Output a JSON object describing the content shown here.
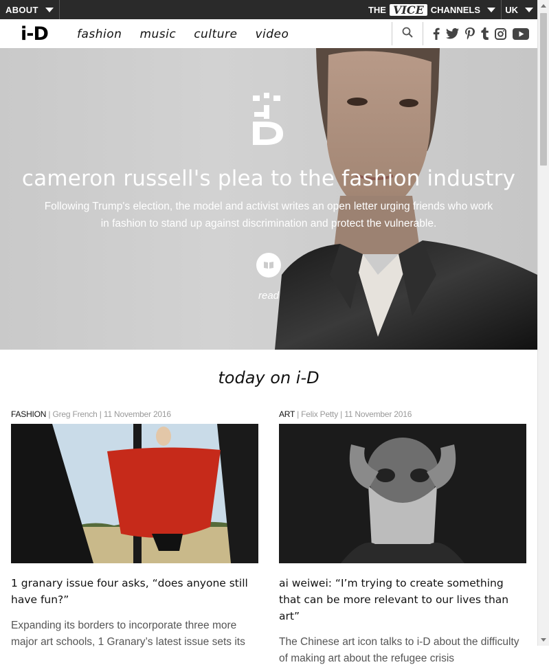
{
  "topbar": {
    "about_label": "ABOUT",
    "channels_prefix": "THE",
    "channels_brand": "VICE",
    "channels_suffix": "CHANNELS",
    "region_label": "UK"
  },
  "nav": {
    "logo": "i-D",
    "items": [
      "fashion",
      "music",
      "culture",
      "video"
    ],
    "social_icons": [
      "facebook-icon",
      "twitter-icon",
      "pinterest-icon",
      "tumblr-icon",
      "instagram-icon",
      "youtube-icon"
    ]
  },
  "hero": {
    "title": "cameron russell's plea to the fashion industry",
    "subtitle": "Following Trump's election, the model and activist writes an open letter urging friends who work in fashion to stand up against discrimination and protect the vulnerable.",
    "read_label": "read"
  },
  "section": {
    "title": "today on i-D"
  },
  "articles": [
    {
      "category": "FASHION",
      "author": "Greg French",
      "date": "11 November 2016",
      "title": "1 granary issue four asks, “does anyone still have fun?”",
      "excerpt": "Expanding its borders to incorporate three more major art schools, 1 Granary’s latest issue sets its"
    },
    {
      "category": "ART",
      "author": "Felix Petty",
      "date": "11 November 2016",
      "title": "ai weiwei: “I’m trying to create something that can be more relevant to our lives than art”",
      "excerpt": "The Chinese art icon talks to i-D about the difficulty of making art about the refugee crisis"
    }
  ]
}
